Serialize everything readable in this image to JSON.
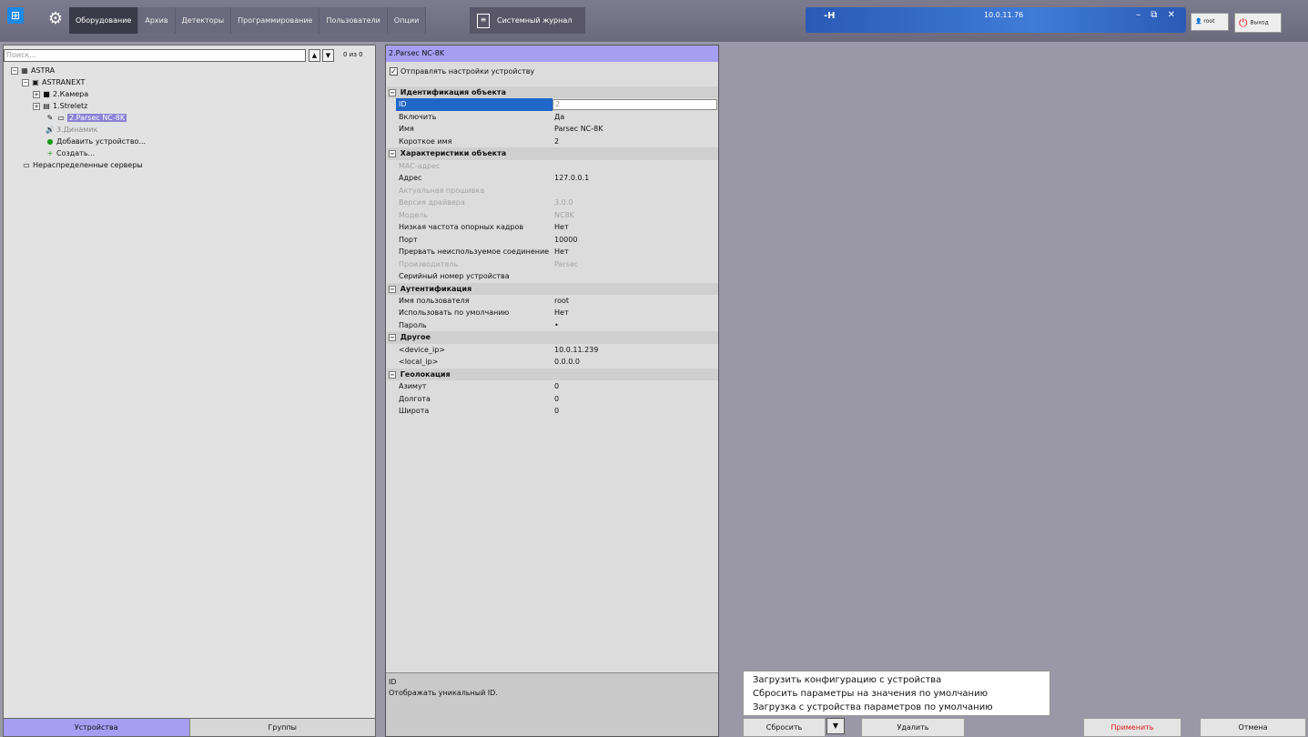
{
  "topbar": {
    "tabs": [
      "Оборудование",
      "Архив",
      "Детекторы",
      "Программирование",
      "Пользователи",
      "Опции"
    ],
    "journal_label": "Системный журнал",
    "server_ip": "10.0.11.76",
    "user_label": "root",
    "exit_label": "Выход",
    "window_controls": "– ⧉ ✕"
  },
  "left": {
    "search_placeholder": "Поиск...",
    "counter": "0 из 0",
    "tree": {
      "astra": "ASTRA",
      "astranext": "ASTRANEXT",
      "camera": "2.Камера",
      "streletz": "1.Streletz",
      "parsec": "2.Parsec NC-8K",
      "speaker": "3.Динамик",
      "add_device": "Добавить устройство...",
      "create": "Создать...",
      "unassigned": "Нераспределенные серверы"
    },
    "tab_devices": "Устройства",
    "tab_groups": "Группы"
  },
  "mid": {
    "title": "2.Parsec NC-8K",
    "send_settings": "Отправлять настройки устройству",
    "groups": {
      "ident": "Идентификация объекта",
      "char": "Характеристики объекта",
      "auth": "Аутентификация",
      "other": "Другое",
      "geo": "Геолокация"
    },
    "props": {
      "id_k": "ID",
      "id_v": "2",
      "enable_k": "Включить",
      "enable_v": "Да",
      "name_k": "Имя",
      "name_v": "Parsec NC-8K",
      "short_k": "Короткое имя",
      "short_v": "2",
      "mac_k": "MAC-адрес",
      "mac_v": "",
      "addr_k": "Адрес",
      "addr_v": "127.0.0.1",
      "fw_k": "Актуальная прошивка",
      "fw_v": "",
      "drv_k": "Версия драйвера",
      "drv_v": "3.0.0",
      "model_k": "Модель",
      "model_v": "NC8K",
      "lowfps_k": "Низкая частота опорных кадров",
      "lowfps_v": "Нет",
      "port_k": "Порт",
      "port_v": "10000",
      "drop_k": "Прервать неиспользуемое соединение",
      "drop_v": "Нет",
      "vendor_k": "Производитель",
      "vendor_v": "Parsec",
      "serial_k": "Серийный номер устройства",
      "serial_v": "",
      "user_k": "Имя пользователя",
      "user_v": "root",
      "def_k": "Использовать по умолчанию",
      "def_v": "Нет",
      "pwd_k": "Пароль",
      "pwd_v": "•",
      "devip_k": "<device_ip>",
      "devip_v": "10.0.11.239",
      "locip_k": "<local_ip>",
      "locip_v": "0.0.0.0",
      "az_k": "Азимут",
      "az_v": "0",
      "lon_k": "Долгота",
      "lon_v": "0",
      "lat_k": "Широта",
      "lat_v": "0"
    },
    "desc_title": "ID",
    "desc_text": "Отображать уникальный ID."
  },
  "popup": {
    "item1": "Загрузить конфигурацию с устройства",
    "item2": "Сбросить параметры на значения по умолчанию",
    "item3": "Загрузка с устройства параметров по умолчанию"
  },
  "actions": {
    "reset": "Сбросить",
    "delete": "Удалить",
    "apply": "Применить",
    "cancel": "Отмена"
  },
  "colors": {
    "accent_lavender": "#a59ef2",
    "selection_blue": "#1f66c8",
    "apply_red": "#e02020"
  }
}
